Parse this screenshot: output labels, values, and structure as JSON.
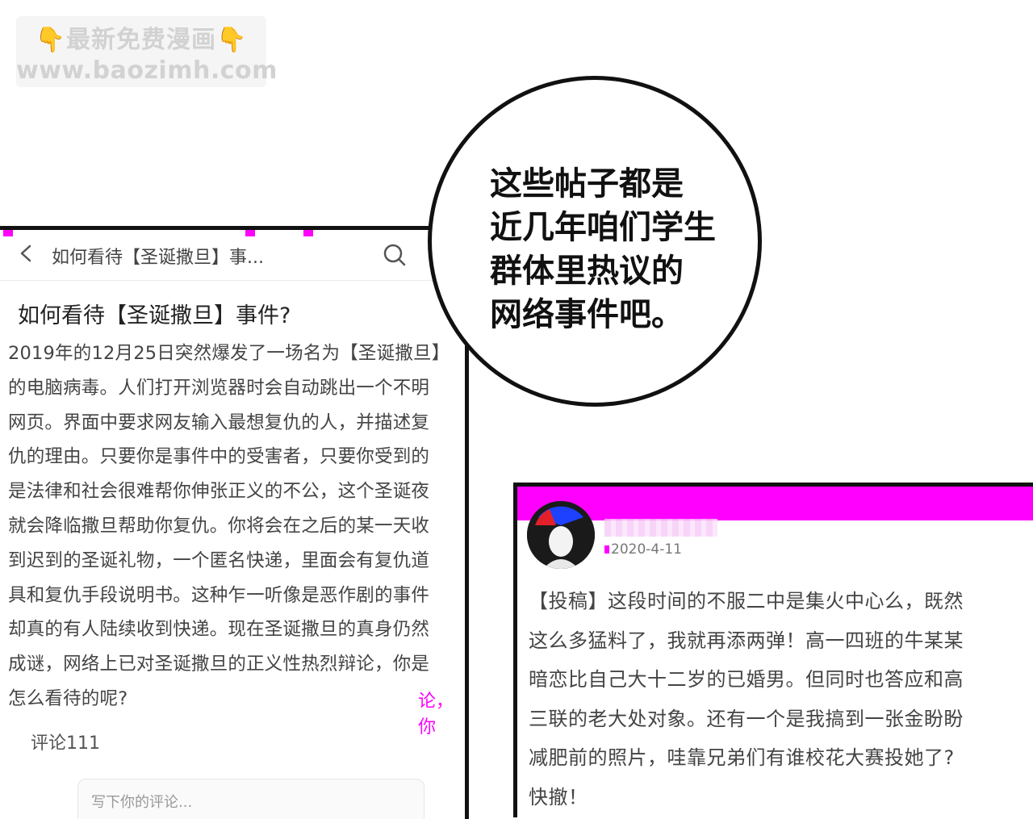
{
  "watermark": {
    "line1_hand_left": "👇",
    "line1_text": "最新免费漫画",
    "line1_hand_right": "👇",
    "line2": "www.baozimh.com"
  },
  "speech_bubble": {
    "lines": [
      "这些帖子都是",
      "近几年咱们学生",
      "群体里热议的",
      "网络事件吧。"
    ]
  },
  "forum_post": {
    "topbar_title": "如何看待【圣诞撒旦】事...",
    "title": "如何看待【圣诞撒旦】事件?",
    "body_lines": [
      "2019年的12月25日突然爆发了一场名为【圣诞撒旦】",
      "的电脑病毒。人们打开浏览器时会自动跳出一个不明",
      "网页。界面中要求网友输入最想复仇的人，并描述复",
      "仇的理由。只要你是事件中的受害者，只要你受到的",
      "是法律和社会很难帮你伸张正义的不公，这个圣诞夜",
      "就会降临撒旦帮助你复仇。你将会在之后的某一天收",
      "到迟到的圣诞礼物，一个匿名快递，里面会有复仇道",
      "具和复仇手段说明书。这种乍一听像是恶作剧的事件",
      "却真的有人陆续收到快递。现在圣诞撒旦的真身仍然",
      "成谜，网络上已对圣诞撒旦的正义性热烈辩论，你是",
      "怎么看待的呢?"
    ],
    "stray_text": "论，你",
    "comment_count": "评论111",
    "comment_placeholder": "写下你的评论..."
  },
  "submission_post": {
    "date": "2020-4-11",
    "body_lines": [
      "【投稿】这段时间的不服二中是集火中心么，既然",
      "这么多猛料了，我就再添两弹！高一四班的牛某某",
      "暗恋比自己大十二岁的已婚男。但同时也答应和高",
      "三联的老大处对象。还有一个是我搞到一张金盼盼",
      "减肥前的照片，哇靠兄弟们有谁校花大赛投她了?",
      "快撤！"
    ]
  },
  "colors": {
    "glitch": "#ff00ff",
    "panel_border": "#111111",
    "watermark_text": "#d2d2d2"
  },
  "icons": [
    "back-arrow-icon",
    "search-icon"
  ]
}
